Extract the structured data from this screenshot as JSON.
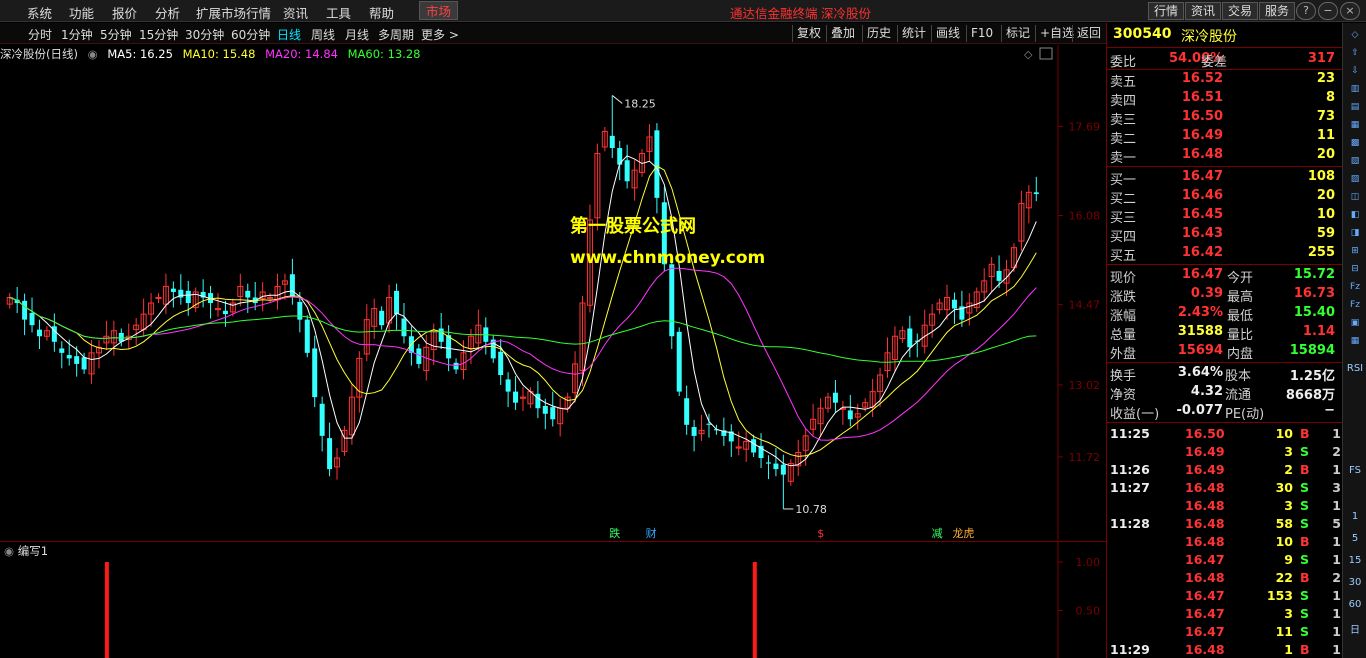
{
  "menubar": {
    "items": [
      "系统",
      "功能",
      "报价",
      "分析",
      "扩展市场行情",
      "资讯",
      "工具",
      "帮助"
    ],
    "market_tab": "市场",
    "brand": "通达信金融终端",
    "stock": "深冷股份",
    "right_buttons": [
      "行情",
      "资讯",
      "交易",
      "服务"
    ],
    "window_buttons": [
      "?",
      "−",
      "□",
      "×"
    ]
  },
  "periodbar": {
    "periods": [
      "分时",
      "1分钟",
      "5分钟",
      "15分钟",
      "30分钟",
      "60分钟",
      "日线",
      "周线",
      "月线",
      "多周期",
      "更多 >"
    ],
    "selected": "日线",
    "tools": [
      "复权",
      "叠加",
      "历史",
      "统计",
      "画线",
      "F10",
      "标记",
      "+自选",
      "返回"
    ]
  },
  "mainchart": {
    "title": "深冷股份(日线)",
    "ma": [
      {
        "label": "MA5: 16.25",
        "color": "#ffffff"
      },
      {
        "label": "MA10: 15.48",
        "color": "#ffff33"
      },
      {
        "label": "MA20: 14.84",
        "color": "#ff33ff"
      },
      {
        "label": "MA60: 13.28",
        "color": "#33ff33"
      }
    ],
    "high_label": "18.25",
    "low_label": "10.78",
    "markers": [
      {
        "text": "跌",
        "color": "#33ff66"
      },
      {
        "text": "财",
        "color": "#33aaff"
      },
      {
        "text": "$",
        "color": "#ff3333"
      },
      {
        "text": "减",
        "color": "#33ff66"
      },
      {
        "text": "龙虎",
        "color": "#ffaa33"
      }
    ]
  },
  "subchart": {
    "title": "编写1",
    "axis_labels": [
      "1.00",
      "0.50"
    ]
  },
  "watermark": {
    "line1": "第一股票公式网",
    "line2": "www.chnmoney.com"
  },
  "chart_data": {
    "type": "candlestick",
    "y_axis_ticks": [
      17.69,
      16.08,
      14.47,
      13.02,
      11.72
    ],
    "ylim": [
      10.4,
      18.8
    ],
    "ma_latest": {
      "MA5": 16.25,
      "MA10": 15.48,
      "MA20": 14.84,
      "MA60": 13.28
    },
    "high": 18.25,
    "low": 10.78,
    "close_series": [
      14.6,
      14.5,
      14.2,
      14.1,
      13.9,
      14.0,
      13.8,
      13.6,
      13.5,
      13.4,
      13.3,
      13.6,
      13.7,
      13.9,
      14.0,
      13.8,
      13.9,
      14.1,
      14.3,
      14.5,
      14.6,
      14.8,
      14.7,
      14.6,
      14.5,
      14.7,
      14.6,
      14.5,
      14.4,
      14.3,
      14.5,
      14.8,
      14.6,
      14.5,
      14.7,
      14.6,
      14.8,
      14.9,
      14.6,
      14.2,
      13.6,
      12.8,
      12.1,
      11.5,
      11.7,
      12.2,
      12.8,
      13.5,
      14.2,
      14.4,
      14.1,
      14.6,
      14.3,
      13.9,
      13.6,
      13.4,
      13.7,
      14.0,
      13.8,
      13.5,
      13.3,
      13.6,
      13.9,
      14.1,
      13.8,
      13.5,
      13.2,
      12.9,
      12.7,
      12.8,
      12.9,
      12.6,
      12.5,
      12.4,
      12.6,
      12.8,
      13.4,
      14.5,
      16.0,
      17.2,
      17.6,
      17.3,
      17.0,
      16.7,
      16.9,
      17.2,
      17.5,
      16.4,
      15.2,
      13.9,
      12.9,
      12.3,
      12.1,
      12.2,
      12.3,
      12.2,
      12.1,
      12.0,
      11.9,
      12.0,
      11.8,
      11.7,
      11.6,
      11.5,
      11.4,
      11.6,
      11.8,
      12.1,
      12.4,
      12.6,
      12.8,
      12.7,
      12.6,
      12.4,
      12.5,
      12.7,
      12.9,
      13.2,
      13.6,
      13.9,
      14.0,
      13.7,
      13.8,
      14.1,
      14.3,
      14.5,
      14.6,
      14.4,
      14.2,
      14.5,
      14.7,
      14.9,
      15.2,
      14.9,
      15.1,
      15.5,
      16.3,
      16.5,
      16.47
    ],
    "sub_signals": [
      {
        "position": 0.097,
        "value": 1.0
      },
      {
        "position": 0.72,
        "value": 1.0
      }
    ]
  },
  "quote": {
    "code": "300540",
    "name": "深冷股份",
    "weibi_label": "委比",
    "weibi": "54.00%",
    "weicha_label": "委差",
    "weicha": "317",
    "asks": [
      {
        "label": "卖五",
        "price": "16.52",
        "vol": "23"
      },
      {
        "label": "卖四",
        "price": "16.51",
        "vol": "8"
      },
      {
        "label": "卖三",
        "price": "16.50",
        "vol": "73"
      },
      {
        "label": "卖二",
        "price": "16.49",
        "vol": "11"
      },
      {
        "label": "卖一",
        "price": "16.48",
        "vol": "20"
      }
    ],
    "bids": [
      {
        "label": "买一",
        "price": "16.47",
        "vol": "108"
      },
      {
        "label": "买二",
        "price": "16.46",
        "vol": "20"
      },
      {
        "label": "买三",
        "price": "16.45",
        "vol": "10"
      },
      {
        "label": "买四",
        "price": "16.43",
        "vol": "59"
      },
      {
        "label": "买五",
        "price": "16.42",
        "vol": "255"
      }
    ],
    "stats": [
      {
        "l1": "现价",
        "v1": "16.47",
        "c1": "#ff3333",
        "l2": "今开",
        "v2": "15.72",
        "c2": "#33ff33"
      },
      {
        "l1": "涨跌",
        "v1": "0.39",
        "c1": "#ff3333",
        "l2": "最高",
        "v2": "16.73",
        "c2": "#ff3333"
      },
      {
        "l1": "涨幅",
        "v1": "2.43%",
        "c1": "#ff3333",
        "l2": "最低",
        "v2": "15.40",
        "c2": "#33ff33"
      },
      {
        "l1": "总量",
        "v1": "31588",
        "c1": "#ffff33",
        "l2": "量比",
        "v2": "1.14",
        "c2": "#ff3333"
      },
      {
        "l1": "外盘",
        "v1": "15694",
        "c1": "#ff3333",
        "l2": "内盘",
        "v2": "15894",
        "c2": "#33ff33"
      }
    ],
    "fund": [
      {
        "l1": "换手",
        "v1": "3.64%",
        "l2": "股本",
        "v2": "1.25亿"
      },
      {
        "l1": "净资",
        "v1": "4.32",
        "l2": "流通",
        "v2": "8668万"
      },
      {
        "l1": "收益(一)",
        "v1": "-0.077",
        "l2": "PE(动)",
        "v2": "−"
      }
    ],
    "ticks": [
      {
        "time": "11:25",
        "price": "16.50",
        "vol": "10",
        "bs": "B",
        "n": "1"
      },
      {
        "time": "",
        "price": "16.49",
        "vol": "3",
        "bs": "S",
        "n": "2"
      },
      {
        "time": "11:26",
        "price": "16.49",
        "vol": "2",
        "bs": "B",
        "n": "1"
      },
      {
        "time": "11:27",
        "price": "16.48",
        "vol": "30",
        "bs": "S",
        "n": "3"
      },
      {
        "time": "",
        "price": "16.48",
        "vol": "3",
        "bs": "S",
        "n": "1"
      },
      {
        "time": "11:28",
        "price": "16.48",
        "vol": "58",
        "bs": "S",
        "n": "5"
      },
      {
        "time": "",
        "price": "16.48",
        "vol": "10",
        "bs": "B",
        "n": "1"
      },
      {
        "time": "",
        "price": "16.47",
        "vol": "9",
        "bs": "S",
        "n": "1"
      },
      {
        "time": "",
        "price": "16.48",
        "vol": "22",
        "bs": "B",
        "n": "2"
      },
      {
        "time": "",
        "price": "16.47",
        "vol": "153",
        "bs": "S",
        "n": "1"
      },
      {
        "time": "",
        "price": "16.47",
        "vol": "3",
        "bs": "S",
        "n": "1"
      },
      {
        "time": "",
        "price": "16.47",
        "vol": "11",
        "bs": "S",
        "n": "1"
      },
      {
        "time": "11:29",
        "price": "16.48",
        "vol": "1",
        "bs": "B",
        "n": "1"
      }
    ]
  },
  "sidebar": {
    "labels": [
      "RSI",
      "FS",
      "1",
      "5",
      "15",
      "30",
      "60",
      "日"
    ]
  },
  "colors": {
    "up": "#ff3333",
    "down": "#33ffff",
    "ma5": "#ffffff",
    "ma10": "#ffff33",
    "ma20": "#ff33ff",
    "ma60": "#33ff33",
    "border": "#7a0000"
  }
}
